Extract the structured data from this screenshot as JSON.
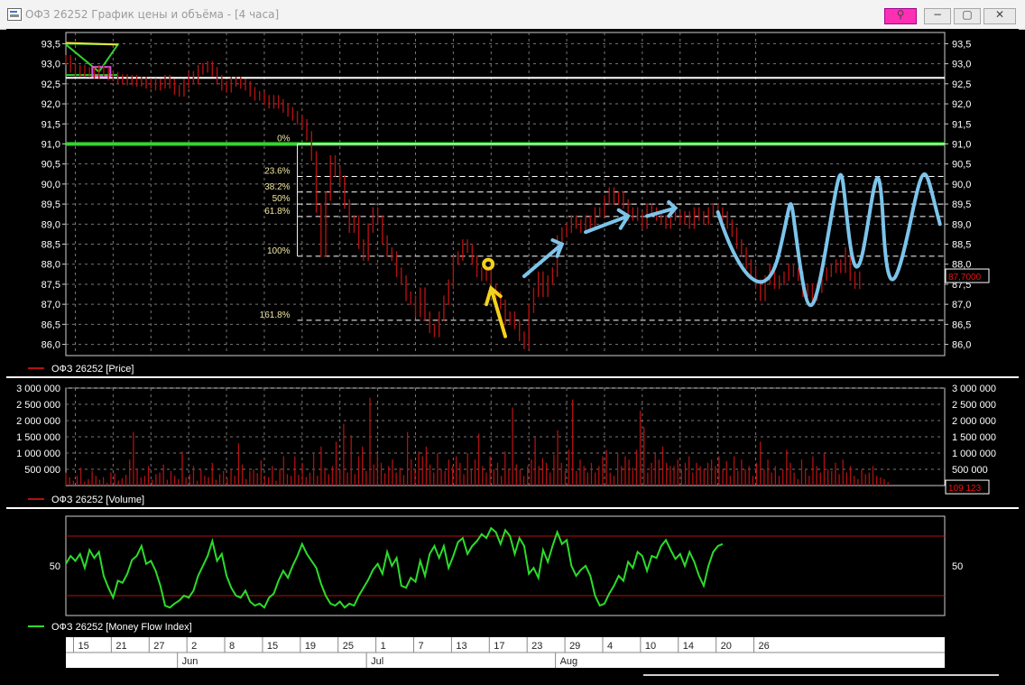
{
  "window": {
    "title": "ОФЗ 26252 График цены и объёма - [4 часа]",
    "buttons": {
      "pin": "pin-icon",
      "minimize": "−",
      "maximize": "▢",
      "close": "✕"
    }
  },
  "colors": {
    "price": "#b01111",
    "volume": "#b01111",
    "mfi": "#2bdc2b",
    "grid": "#777777",
    "fib": "#f0e6a0",
    "level_green": "#34d431",
    "level_white": "#ffffff",
    "mfi_band": "#b01010",
    "annotation_blue": "#7cc4ea",
    "annotation_yellow": "#f3d21b"
  },
  "chart_data": [
    {
      "type": "line",
      "title": "",
      "legend": "ОФЗ 26252 [Price]",
      "ylim": [
        85.72,
        93.78
      ],
      "y_ticks": [
        "86,0",
        "86,5",
        "87,0",
        "87,5",
        "88,0",
        "88,5",
        "89,0",
        "89,5",
        "90,0",
        "90,5",
        "91,0",
        "91,5",
        "92,0",
        "92,5",
        "93,0",
        "93,5"
      ],
      "last_value_label": "87,7000",
      "x": [
        0,
        0.5,
        1,
        1.5,
        2,
        2.5,
        3,
        3.5,
        4,
        4.5,
        5,
        5.5,
        6,
        6.5,
        7,
        7.5,
        8,
        8.5,
        9,
        9.5,
        10,
        10.5,
        11,
        11.5,
        12,
        12.5,
        13,
        13.5,
        14,
        14.5,
        15,
        15.5,
        16,
        16.5,
        17,
        17.5,
        18,
        18.5,
        19,
        19.5,
        20,
        20.5,
        21,
        21.5,
        22,
        22.5,
        23,
        23.5,
        24,
        24.5,
        25,
        25.5,
        26,
        26.5,
        27,
        27.5,
        28,
        28.5,
        29,
        29.5,
        30,
        30.5,
        31,
        31.5,
        32,
        32.5,
        33,
        33.5,
        34,
        34.5,
        35,
        35.5,
        36,
        36.5,
        37,
        37.5,
        38,
        38.5,
        39,
        39.5,
        40,
        40.5,
        41,
        41.5,
        42,
        42.5,
        43,
        43.5,
        44,
        44.5,
        45,
        45.5,
        46,
        46.5,
        47,
        47.5,
        48,
        48.5,
        49,
        49.5,
        50,
        50.5,
        51,
        51.5,
        52,
        52.5,
        53,
        53.5,
        54,
        54.5,
        55,
        55.5,
        56,
        56.5,
        57,
        57.5,
        58,
        58.5,
        59,
        59.5,
        60,
        60.5,
        61,
        61.5,
        62,
        62.5,
        63,
        63.5,
        64,
        64.5,
        65,
        65.5,
        66,
        66.5,
        67,
        67.5,
        68,
        68.5,
        69,
        69.5,
        70,
        70.5,
        71,
        71.5,
        72,
        72.5,
        73,
        73.5,
        74,
        74.5,
        75,
        75.5,
        76,
        76.5,
        77,
        77.5,
        78,
        78.5,
        79,
        79.5,
        80,
        80.5,
        81,
        81.5,
        82,
        82.5,
        83,
        83.5,
        84,
        84.5,
        85,
        85.5,
        86,
        86.5,
        87
      ],
      "values": [
        93.1,
        92.9,
        92.8,
        92.85,
        92.8,
        92.78,
        92.75,
        92.85,
        92.8,
        92.7,
        92.68,
        92.6,
        92.62,
        92.58,
        92.6,
        92.55,
        92.55,
        92.5,
        92.52,
        92.45,
        92.5,
        92.6,
        92.5,
        92.35,
        92.3,
        92.5,
        92.7,
        92.6,
        92.85,
        92.9,
        92.95,
        92.8,
        92.6,
        92.45,
        92.4,
        92.55,
        92.55,
        92.5,
        92.45,
        92.3,
        92.2,
        92.2,
        92.1,
        92.0,
        92.1,
        92.0,
        91.9,
        91.8,
        91.7,
        91.6,
        91.5,
        91.2,
        90.7,
        89.4,
        88.3,
        89.7,
        90.6,
        90.3,
        90.1,
        89.5,
        88.9,
        89.1,
        88.5,
        88.2,
        88.9,
        89.3,
        89.1,
        88.6,
        88.3,
        88.2,
        87.8,
        87.6,
        87.2,
        87.1,
        86.8,
        87.3,
        86.7,
        86.4,
        86.3,
        86.7,
        87.1,
        87.5,
        88.1,
        88.2,
        88.5,
        88.4,
        88.1,
        87.8,
        87.7,
        87.8,
        87.4,
        87.2,
        87.0,
        86.6,
        86.7,
        86.5,
        86.2,
        86.0,
        86.9,
        87.3,
        87.7,
        87.3,
        87.6,
        87.8,
        88.6,
        88.8,
        88.9,
        89.1,
        89.0,
        88.9,
        89.1,
        89.0,
        89.3,
        89.3,
        89.6,
        89.8,
        89.6,
        89.7,
        89.5,
        89.2,
        89.3,
        89.2,
        89.0,
        89.4,
        89.3,
        89.2,
        89.1,
        89.0,
        89.2,
        89.2,
        89.1,
        89.2,
        89.0,
        89.3,
        89.2,
        89.1,
        89.3,
        89.4,
        89.3,
        89.2,
        89.0,
        88.8,
        88.5,
        88.3,
        88.0,
        87.8,
        87.5,
        87.2,
        87.6,
        87.9,
        87.5,
        87.6,
        87.7,
        87.9,
        87.8,
        87.7,
        87.3,
        87.4,
        87.2,
        87.4,
        87.7,
        87.8,
        87.9,
        88.0,
        87.9,
        88.3,
        87.7,
        87.5,
        87.7
      ]
    },
    {
      "type": "bar",
      "title": "",
      "legend": "ОФЗ 26252 [Volume]",
      "ylim": [
        0,
        3000000
      ],
      "y_ticks": [
        "500 000",
        "1 000 000",
        "1 500 000",
        "2 000 000",
        "2 500 000",
        "3 000 000"
      ],
      "last_value_label": "109 123",
      "values": [
        400000,
        250000,
        150000,
        300000,
        550000,
        120000,
        200000,
        450000,
        300000,
        180000,
        260000,
        90000,
        400000,
        380000,
        150000,
        220000,
        330000,
        800000,
        1650000,
        500000,
        250000,
        300000,
        600000,
        180000,
        350000,
        400000,
        650000,
        180000,
        450000,
        300000,
        200000,
        1050000,
        250000,
        350000,
        600000,
        150000,
        480000,
        300000,
        260000,
        700000,
        180000,
        350000,
        450000,
        210000,
        500000,
        300000,
        1300000,
        650000,
        200000,
        450000,
        500000,
        380000,
        780000,
        300000,
        260000,
        600000,
        150000,
        520000,
        900000,
        350000,
        300000,
        900000,
        330000,
        700000,
        260000,
        400000,
        1000000,
        300000,
        1200000,
        550000,
        350000,
        600000,
        1350000,
        500000,
        1900000,
        400000,
        1550000,
        350000,
        900000,
        1200000,
        450000,
        2700000,
        650000,
        1000000,
        700000,
        380000,
        600000,
        800000,
        400000,
        550000,
        320000,
        1650000,
        800000,
        500000,
        1050000,
        900000,
        1200000,
        650000,
        400000,
        1000000,
        500000,
        450000,
        800000,
        600000,
        900000,
        700000,
        350000,
        1000000,
        480000,
        800000,
        1600000,
        600000,
        400000,
        900000,
        500000,
        700000,
        300000,
        1050000,
        520000,
        2400000,
        650000,
        500000,
        300000,
        600000,
        800000,
        1500000,
        600000,
        850000,
        700000,
        400000,
        950000,
        1700000,
        700000,
        450000,
        1100000,
        2650000,
        450000,
        800000,
        600000,
        400000,
        700000,
        400000,
        600000,
        900000,
        1100000,
        400000,
        300000,
        1000000,
        600000,
        900000,
        800000,
        550000,
        1100000,
        2300000,
        1800000,
        400000,
        700000,
        1000000,
        800000,
        1200000,
        700000,
        600000,
        600000,
        800000,
        500000,
        700000,
        900000,
        400000,
        700000,
        600000,
        500000,
        700000,
        800000,
        600000,
        900000,
        500000,
        750000,
        300000,
        900000,
        450000,
        800000,
        500000,
        600000,
        300000,
        700000,
        1350000,
        500000,
        800000,
        400000,
        600000,
        300000,
        500000,
        1100000,
        700000,
        400000,
        200000,
        800000,
        500000,
        300000,
        900000,
        600000,
        400000,
        1000000,
        500000,
        450000,
        700000,
        350000,
        800000,
        400000,
        600000,
        300000,
        200000,
        500000,
        350000,
        400000,
        600000,
        300000,
        250000,
        200000,
        109123
      ]
    },
    {
      "type": "line",
      "title": "",
      "legend": "ОФЗ 26252 [Money Flow Index]",
      "ylim": [
        0,
        100
      ],
      "y_ticks": [
        "50"
      ],
      "bands": [
        20,
        80
      ],
      "x": [
        0,
        0.5,
        1,
        1.5,
        2,
        2.5,
        3,
        3.5,
        4,
        4.5,
        5,
        5.5,
        6,
        6.5,
        7,
        7.5,
        8,
        8.5,
        9,
        9.5,
        10,
        10.5,
        11,
        11.5,
        12,
        12.5,
        13,
        13.5,
        14,
        14.5,
        15,
        15.5,
        16,
        16.5,
        17,
        17.5,
        18,
        18.5,
        19,
        19.5,
        20,
        20.5,
        21,
        21.5,
        22,
        22.5,
        23,
        23.5,
        24,
        24.5,
        25,
        25.5,
        26,
        26.5,
        27,
        27.5,
        28,
        28.5,
        29,
        29.5,
        30,
        30.5,
        31,
        31.5,
        32,
        32.5,
        33,
        33.5,
        34,
        34.5,
        35,
        35.5,
        36,
        36.5,
        37,
        37.5,
        38,
        38.5,
        39,
        39.5,
        40,
        40.5,
        41,
        41.5,
        42,
        42.5,
        43,
        43.5,
        44,
        44.5,
        45,
        45.5,
        46,
        46.5,
        47,
        47.5,
        48,
        48.5,
        49,
        49.5,
        50,
        50.5,
        51,
        51.5,
        52,
        52.5,
        53,
        53.5,
        54,
        54.5,
        55,
        55.5,
        56,
        56.5,
        57,
        57.5,
        58,
        58.5,
        59,
        59.5,
        60,
        60.5,
        61,
        61.5,
        62,
        62.5,
        63,
        63.5,
        64,
        64.5,
        65,
        65.5,
        66,
        66.5,
        67,
        67.5,
        68,
        68.5,
        69,
        69.5,
        70,
        70.5,
        71,
        71.5,
        72,
        72.5,
        73,
        73.5,
        74,
        74.5,
        75,
        75.5,
        76,
        76.5,
        77,
        77.5,
        78,
        78.5,
        79,
        79.5,
        80,
        80.5,
        81,
        81.5,
        82,
        82.5,
        83,
        83.5,
        84,
        84.5,
        85,
        85.5,
        86,
        86.5,
        87
      ],
      "values": [
        52,
        60,
        55,
        62,
        48,
        66,
        58,
        64,
        40,
        28,
        18,
        35,
        33,
        42,
        56,
        60,
        70,
        52,
        55,
        45,
        30,
        10,
        8,
        12,
        15,
        20,
        18,
        25,
        40,
        50,
        60,
        75,
        55,
        62,
        40,
        28,
        20,
        18,
        25,
        14,
        10,
        12,
        8,
        18,
        22,
        35,
        45,
        38,
        50,
        60,
        72,
        62,
        55,
        48,
        32,
        20,
        12,
        10,
        14,
        8,
        12,
        10,
        20,
        28,
        36,
        46,
        52,
        42,
        64,
        50,
        58,
        30,
        28,
        38,
        34,
        55,
        40,
        62,
        70,
        58,
        70,
        48,
        60,
        74,
        78,
        62,
        70,
        75,
        82,
        78,
        88,
        84,
        72,
        86,
        80,
        62,
        78,
        70,
        42,
        48,
        38,
        66,
        54,
        70,
        84,
        72,
        76,
        50,
        40,
        46,
        50,
        40,
        20,
        10,
        12,
        22,
        30,
        40,
        35,
        54,
        48,
        64,
        60,
        45,
        60,
        58,
        70,
        76,
        66,
        57,
        62,
        50,
        64,
        54,
        40,
        30,
        50,
        64,
        70,
        72
      ]
    }
  ],
  "fibonacci": [
    {
      "label": "0%",
      "value": 91.0
    },
    {
      "label": "23.6%",
      "value": 90.19
    },
    {
      "label": "38.2%",
      "value": 89.8
    },
    {
      "label": "50%",
      "value": 89.5
    },
    {
      "label": "61.8%",
      "value": 89.19
    },
    {
      "label": "100%",
      "value": 88.2
    },
    {
      "label": "161.8%",
      "value": 86.6
    }
  ],
  "levels": [
    {
      "value": 91.0,
      "color": "#34d431"
    },
    {
      "value": 92.65,
      "color": "#ffffff"
    }
  ],
  "time_axis": {
    "days": [
      {
        "label": "15",
        "x": 1
      },
      {
        "label": "21",
        "x": 5
      },
      {
        "label": "27",
        "x": 9
      },
      {
        "label": "2",
        "x": 13
      },
      {
        "label": "8",
        "x": 17
      },
      {
        "label": "15",
        "x": 21
      },
      {
        "label": "19",
        "x": 25
      },
      {
        "label": "25",
        "x": 29
      },
      {
        "label": "1",
        "x": 33
      },
      {
        "label": "7",
        "x": 37
      },
      {
        "label": "13",
        "x": 41
      },
      {
        "label": "17",
        "x": 45
      },
      {
        "label": "23",
        "x": 49
      },
      {
        "label": "29",
        "x": 53
      },
      {
        "label": "4",
        "x": 57
      },
      {
        "label": "10",
        "x": 61
      },
      {
        "label": "14",
        "x": 65
      },
      {
        "label": "20",
        "x": 69
      },
      {
        "label": "26",
        "x": 73
      }
    ],
    "months": [
      {
        "label": "Jun",
        "x": 12
      },
      {
        "label": "Jul",
        "x": 32
      },
      {
        "label": "Aug",
        "x": 52
      }
    ]
  }
}
